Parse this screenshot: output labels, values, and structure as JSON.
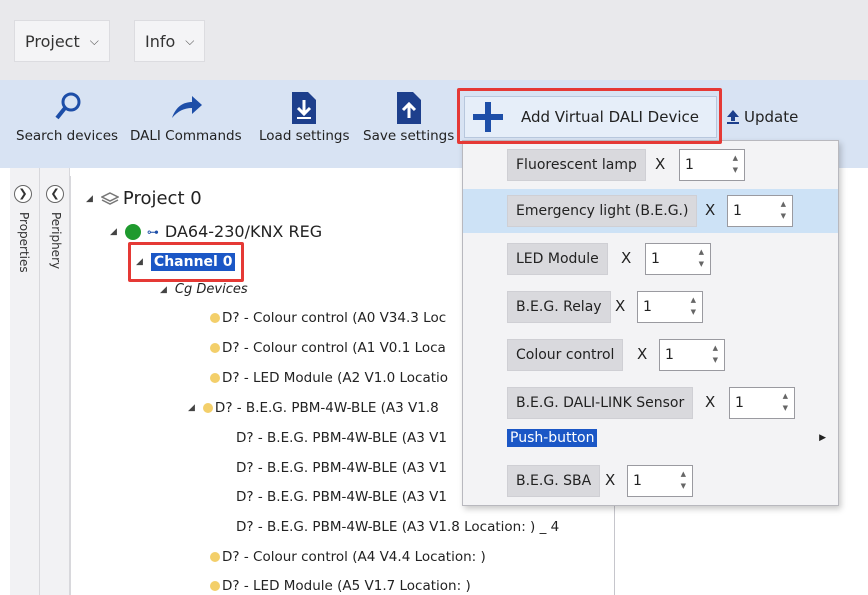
{
  "menubar": {
    "project_label": "Project",
    "info_label": "Info"
  },
  "toolbar": {
    "search_label": "Search devices",
    "commands_label": "DALI Commands",
    "load_label": "Load settings",
    "save_label": "Save settings",
    "add_virtual_label": "Add Virtual DALI Device",
    "update_label": "Update"
  },
  "sidebar": {
    "properties_label": "Properties",
    "periphery_label": "Periphery"
  },
  "tree": {
    "project": "Project 0",
    "gateway": "DA64-230/KNX REG",
    "channel": "Channel 0",
    "group": "Cg Devices",
    "items": [
      "D? - Colour control (A0 V34.3 Loc",
      "D? - Colour control (A1 V0.1 Loca",
      "D? - LED Module (A2 V1.0 Locatio",
      "D? - B.E.G. PBM-4W-BLE (A3 V1.8",
      "D? - B.E.G. PBM-4W-BLE (A3 V1",
      "D? - B.E.G. PBM-4W-BLE (A3 V1",
      "D? - B.E.G. PBM-4W-BLE (A3 V1",
      "D? - B.E.G. PBM-4W-BLE (A3 V1.8 Location: ) _ 4",
      "D? - Colour control (A4 V4.4 Location: )",
      "D? - LED Module (A5 V1.7 Location: )"
    ]
  },
  "dropdown": {
    "items": [
      {
        "label": "Fluorescent lamp",
        "x": "X",
        "qty": "1"
      },
      {
        "label": "Emergency light (B.E.G.)",
        "x": "X",
        "qty": "1"
      },
      {
        "label": "LED Module",
        "x": "X",
        "qty": "1"
      },
      {
        "label": "B.E.G. Relay",
        "x": "X",
        "qty": "1"
      },
      {
        "label": "Colour control",
        "x": "X",
        "qty": "1"
      },
      {
        "label": "B.E.G. DALI-LINK Sensor",
        "x": "X",
        "qty": "1"
      }
    ],
    "push_button": "Push-button",
    "sba": {
      "label": "B.E.G. SBA",
      "x": "X",
      "qty": "1"
    }
  },
  "colors": {
    "accent": "#1b57c6",
    "highlight_box": "#e53935",
    "toolbar_bg": "#d8e3f3"
  }
}
